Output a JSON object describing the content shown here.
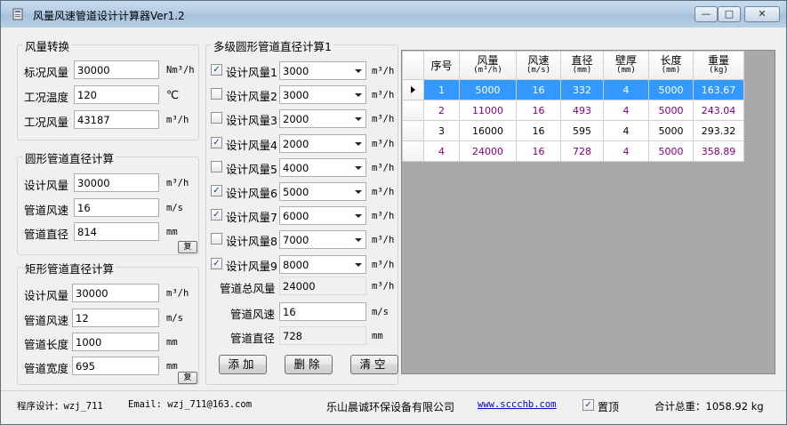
{
  "window": {
    "title": "风量风速管道设计计算器Ver1.2",
    "btn_min": "—",
    "btn_max": "□",
    "btn_close": "✕"
  },
  "airflow_convert": {
    "title": "风量转换",
    "fields": [
      {
        "label": "标况风量",
        "value": "30000",
        "unit": "Nm³/h"
      },
      {
        "label": "工况温度",
        "value": "120",
        "unit": "℃"
      },
      {
        "label": "工况风量",
        "value": "43187",
        "unit": "m³/h"
      }
    ]
  },
  "round_duct": {
    "title": "圆形管道直径计算",
    "fields": [
      {
        "label": "设计风量",
        "value": "30000",
        "unit": "m³/h"
      },
      {
        "label": "管道风速",
        "value": "16",
        "unit": "m/s"
      },
      {
        "label": "管道直径",
        "value": "814",
        "unit": "mm"
      }
    ],
    "btn": "复"
  },
  "rect_duct": {
    "title": "矩形管道直径计算",
    "fields": [
      {
        "label": "设计风量",
        "value": "30000",
        "unit": "m³/h"
      },
      {
        "label": "管道风速",
        "value": "12",
        "unit": "m/s"
      },
      {
        "label": "管道长度",
        "value": "1000",
        "unit": "mm"
      },
      {
        "label": "管道宽度",
        "value": "695",
        "unit": "mm"
      }
    ],
    "btn": "复"
  },
  "multi": {
    "title": "多级圆形管道直径计算1",
    "rows": [
      {
        "label": "设计风量1",
        "value": "3000",
        "unit": "m³/h",
        "checked": true
      },
      {
        "label": "设计风量2",
        "value": "3000",
        "unit": "m³/h",
        "checked": false
      },
      {
        "label": "设计风量3",
        "value": "2000",
        "unit": "m³/h",
        "checked": false
      },
      {
        "label": "设计风量4",
        "value": "2000",
        "unit": "m³/h",
        "checked": true
      },
      {
        "label": "设计风量5",
        "value": "4000",
        "unit": "m³/h",
        "checked": false
      },
      {
        "label": "设计风量6",
        "value": "5000",
        "unit": "m³/h",
        "checked": true
      },
      {
        "label": "设计风量7",
        "value": "6000",
        "unit": "m³/h",
        "checked": true
      },
      {
        "label": "设计风量8",
        "value": "7000",
        "unit": "m³/h",
        "checked": false
      },
      {
        "label": "设计风量9",
        "value": "8000",
        "unit": "m³/h",
        "checked": true
      }
    ],
    "total": {
      "label": "管道总风量",
      "value": "24000",
      "unit": "m³/h"
    },
    "speed": {
      "label": "管道风速",
      "value": "16",
      "unit": "m/s"
    },
    "diameter": {
      "label": "管道直径",
      "value": "728",
      "unit": "mm"
    },
    "btn_add": "添加",
    "btn_delete": "删除",
    "btn_clear": "清空"
  },
  "grid": {
    "headers": [
      {
        "title": "序号",
        "sub": ""
      },
      {
        "title": "风量",
        "sub": "(m³/h)"
      },
      {
        "title": "风速",
        "sub": "(m/s)"
      },
      {
        "title": "直径",
        "sub": "(mm)"
      },
      {
        "title": "壁厚",
        "sub": "(mm)"
      },
      {
        "title": "长度",
        "sub": "(mm)"
      },
      {
        "title": "重量",
        "sub": "(kg)"
      }
    ],
    "rows": [
      [
        "1",
        "5000",
        "16",
        "332",
        "4",
        "5000",
        "163.67"
      ],
      [
        "2",
        "11000",
        "16",
        "493",
        "4",
        "5000",
        "243.04"
      ],
      [
        "3",
        "16000",
        "16",
        "595",
        "4",
        "5000",
        "293.32"
      ],
      [
        "4",
        "24000",
        "16",
        "728",
        "4",
        "5000",
        "358.89"
      ]
    ],
    "selected_row": 0
  },
  "status": {
    "author": "程序设计：wzj_711",
    "email": "Email: wzj_711@163.com",
    "company": "乐山晨诚环保设备有限公司",
    "website": "www.sccchb.com",
    "pin_label": "置顶",
    "pin_checked": true,
    "total_weight": "合计总重：1058.92 kg"
  }
}
